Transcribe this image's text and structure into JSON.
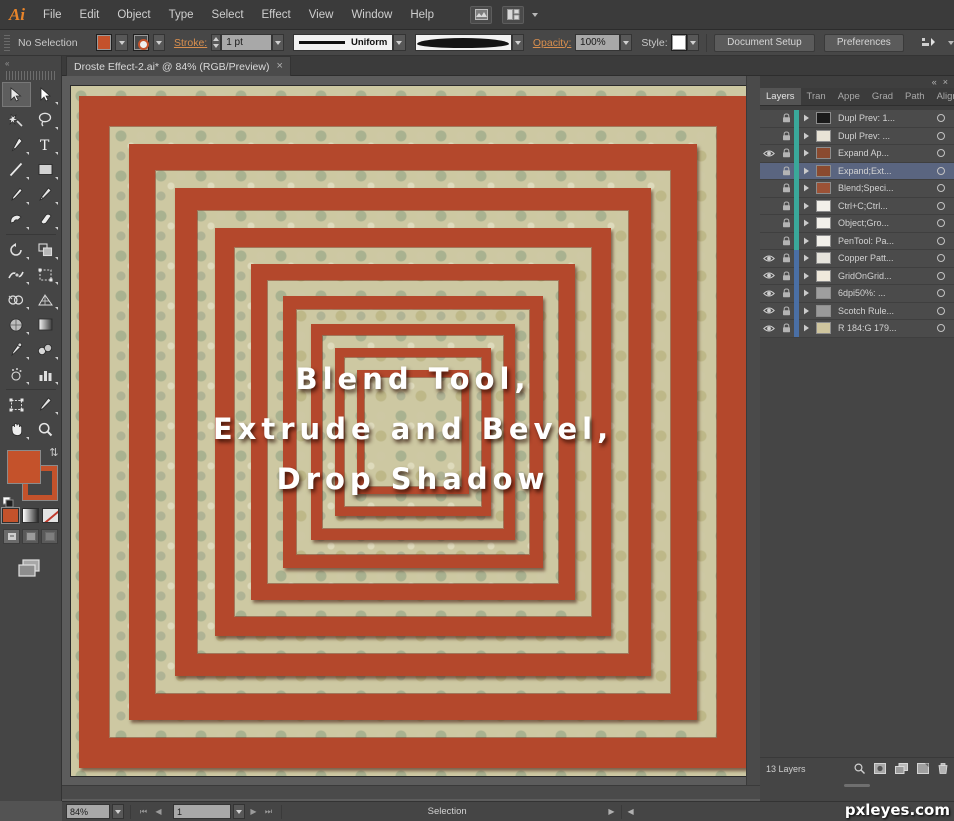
{
  "app": {
    "name": "Adobe Illustrator",
    "logo_text": "Ai"
  },
  "menubar": {
    "items": [
      "File",
      "Edit",
      "Object",
      "Type",
      "Select",
      "Effect",
      "View",
      "Window",
      "Help"
    ],
    "bridge_icon": "bridge-icon",
    "arrange_icon": "arrange-documents-icon"
  },
  "controlbar": {
    "selection_status": "No Selection",
    "fill_swatch_color": "#c4522b",
    "stroke_label": "Stroke:",
    "stroke_weight": "1 pt",
    "brush_definition": "Uniform",
    "opacity_label": "Opacity:",
    "opacity_value": "100%",
    "style_label": "Style:",
    "document_setup_label": "Document Setup",
    "preferences_label": "Preferences"
  },
  "document_tab": {
    "title": "Droste Effect-2.ai* @ 84% (RGB/Preview)",
    "close_glyph": "×"
  },
  "toolbar": {
    "tools": [
      "selection-tool",
      "direct-selection-tool",
      "magic-wand-tool",
      "lasso-tool",
      "pen-tool",
      "type-tool",
      "line-segment-tool",
      "rectangle-tool",
      "paintbrush-tool",
      "pencil-tool",
      "blob-brush-tool",
      "eraser-tool",
      "rotate-tool",
      "scale-tool",
      "width-tool",
      "free-transform-tool",
      "shape-builder-tool",
      "perspective-grid-tool",
      "mesh-tool",
      "gradient-tool",
      "eyedropper-tool",
      "blend-tool",
      "symbol-sprayer-tool",
      "column-graph-tool",
      "artboard-tool",
      "slice-tool",
      "hand-tool",
      "zoom-tool"
    ],
    "selected_tool": "selection-tool",
    "fill_color": "#c4522b",
    "stroke_color": "#c4522b",
    "color_modes": [
      "color-mode",
      "gradient-mode",
      "none-mode"
    ],
    "screen_modes": [
      "normal-screen-mode",
      "full-screen-with-menu-mode",
      "full-screen-mode"
    ],
    "change_screen_mode": "change-screen-mode-button"
  },
  "artwork": {
    "title_lines": [
      "Blend Tool,",
      "Extrude and Bevel,",
      "Drop Shadow"
    ],
    "frame_color": "#b4482c",
    "background_color": "#cdc8a2",
    "frame_count": 9
  },
  "layers_panel": {
    "tabs": [
      "Layers",
      "Tran",
      "Appe",
      "Grad",
      "Path",
      "Align"
    ],
    "active_tab": "Layers",
    "collapse_glyph": "«",
    "close_glyph": "×",
    "layer_count_label": "13 Layers",
    "footer_icons": [
      "locate-object-icon",
      "make-clipping-mask-icon",
      "create-new-sublayer-icon",
      "create-new-layer-icon",
      "delete-selection-icon"
    ],
    "rows": [
      {
        "name": "Dupl Prev: 1...",
        "visible": false,
        "locked": true,
        "selected": false,
        "thumb": "#1a1a1a",
        "bar": "#3aa89a"
      },
      {
        "name": "Dupl Prev: ...",
        "visible": false,
        "locked": true,
        "selected": false,
        "thumb": "#e8e3d6",
        "bar": "#3aa89a"
      },
      {
        "name": "Expand Ap...",
        "visible": true,
        "locked": true,
        "selected": false,
        "thumb": "#8a4a2f",
        "bar": "#3aa89a"
      },
      {
        "name": "Expand;Ext...",
        "visible": false,
        "locked": true,
        "selected": true,
        "thumb": "#8a4a2f",
        "bar": "#3aa89a"
      },
      {
        "name": "Blend;Speci...",
        "visible": false,
        "locked": true,
        "selected": false,
        "thumb": "#9c5236",
        "bar": "#3aa89a"
      },
      {
        "name": "Ctrl+C;Ctrl...",
        "visible": false,
        "locked": true,
        "selected": false,
        "thumb": "#f2f0ea",
        "bar": "#3aa89a"
      },
      {
        "name": "Object;Gro...",
        "visible": false,
        "locked": true,
        "selected": false,
        "thumb": "#f2f0ea",
        "bar": "#3aa89a"
      },
      {
        "name": "PenTool: Pa...",
        "visible": false,
        "locked": true,
        "selected": false,
        "thumb": "#f2f0ea",
        "bar": "#3aa89a"
      },
      {
        "name": "Copper Patt...",
        "visible": true,
        "locked": true,
        "selected": false,
        "thumb": "#e6e4dc",
        "bar": "#4a6fa5"
      },
      {
        "name": "GridOnGrid...",
        "visible": true,
        "locked": true,
        "selected": false,
        "thumb": "#efe9dc",
        "bar": "#4a6fa5"
      },
      {
        "name": "6dpi50%: ...",
        "visible": true,
        "locked": true,
        "selected": false,
        "thumb": "#9e9e9e",
        "bar": "#4a6fa5"
      },
      {
        "name": "Scotch Rule...",
        "visible": true,
        "locked": true,
        "selected": false,
        "thumb": "#9a9a9a",
        "bar": "#4a6fa5"
      },
      {
        "name": "R 184:G 179...",
        "visible": true,
        "locked": true,
        "selected": false,
        "thumb": "#cfc59e",
        "bar": "#4a6fa5"
      }
    ]
  },
  "statusbar": {
    "zoom_level": "84%",
    "page_number": "1",
    "status_text": "Selection",
    "first_page_icon": "first-page-icon",
    "prev_page_icon": "previous-page-icon",
    "next_page_icon": "next-page-icon",
    "last_page_icon": "last-page-icon"
  },
  "watermark": {
    "text": "pxleyes.com"
  }
}
